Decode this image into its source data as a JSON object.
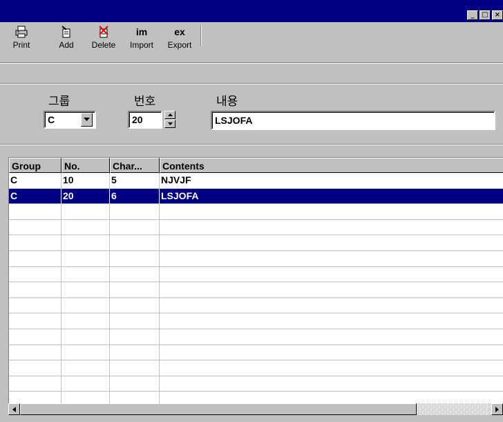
{
  "titlebar": {
    "title": ""
  },
  "window_controls": [
    "minimize",
    "maximize",
    "close"
  ],
  "toolbar": {
    "buttons": [
      {
        "id": "print",
        "label": "Print",
        "icon": "printer-icon",
        "glyph": ""
      },
      {
        "id": "add",
        "label": "Add",
        "icon": "add-document-icon",
        "glyph": ""
      },
      {
        "id": "delete",
        "label": "Delete",
        "icon": "delete-document-icon",
        "glyph": ""
      },
      {
        "id": "import",
        "label": "Import",
        "icon": "import-icon",
        "glyph": "im"
      },
      {
        "id": "export",
        "label": "Export",
        "icon": "export-icon",
        "glyph": "ex"
      }
    ]
  },
  "form": {
    "group_label": "그룹",
    "group_value": "C",
    "number_label": "번호",
    "number_value": "20",
    "contents_label": "내용",
    "contents_value": "LSJOFA"
  },
  "grid": {
    "columns": [
      "Group",
      "No.",
      "Char...",
      "Contents"
    ],
    "rows": [
      [
        "C",
        "10",
        "5",
        "NJVJF"
      ],
      [
        "C",
        "20",
        "6",
        "LSJOFA"
      ]
    ],
    "selected_row": 1,
    "empty_rows": 13
  },
  "colors": {
    "titlebar": "#000080",
    "selection": "#000080",
    "face": "#c0c0c0"
  }
}
